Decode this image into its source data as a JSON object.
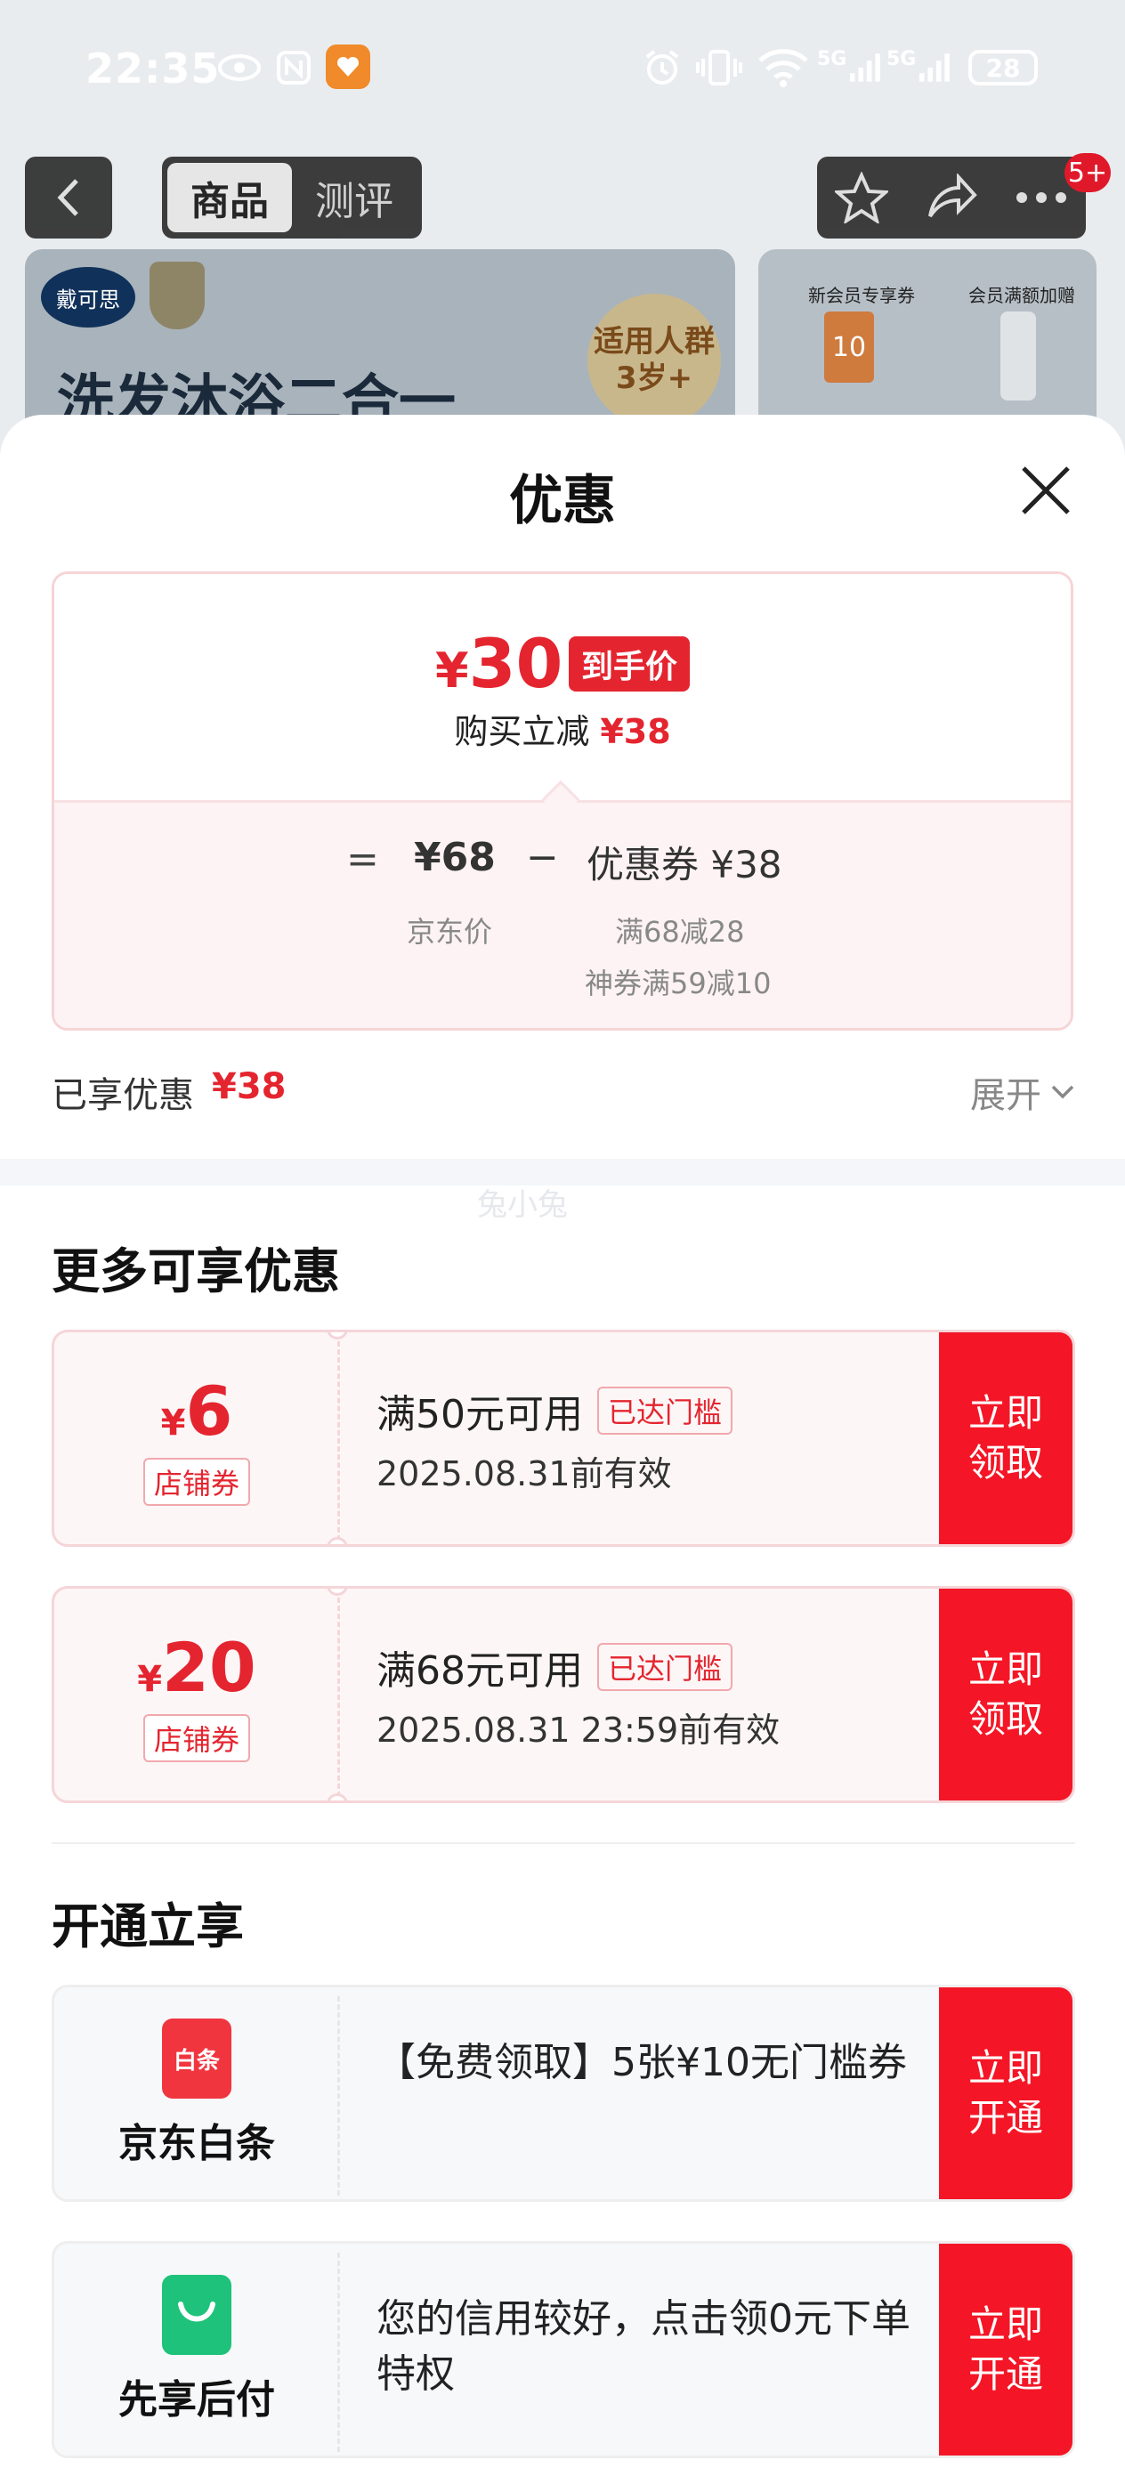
{
  "status_bar": {
    "time": "22:35",
    "signal1_label": "5G",
    "signal2_label": "5G",
    "battery": "28"
  },
  "nav": {
    "tabs": [
      "商品",
      "测评"
    ],
    "badge": "5+"
  },
  "banner": {
    "brand": "戴可思",
    "headline": "洗发沐浴二合一",
    "age_badge_line1": "适用人群",
    "age_badge_line2": "3岁+",
    "right_label1": "新会员专享券",
    "right_label2": "会员满额加赠",
    "right_coupon": "10"
  },
  "sheet": {
    "title": "优惠",
    "price": {
      "yen": "¥",
      "value": "30",
      "tag": "到手价",
      "instant_label": "购买立减",
      "instant_value": "¥38"
    },
    "calc": {
      "eq": "=",
      "jd_price": "¥68",
      "minus": "−",
      "coupon_total": "优惠券 ¥38",
      "jd_price_label": "京东价",
      "detail1": "满68减28",
      "detail2": "神券满59减10"
    },
    "enjoyed": {
      "label": "已享优惠",
      "value": "¥38",
      "expand": "展开"
    },
    "watermark": "兔小兔",
    "more_title": "更多可享优惠",
    "coupons": [
      {
        "yen": "¥",
        "amount": "6",
        "type": "店铺券",
        "condition": "满50元可用",
        "status": "已达门槛",
        "validity": "2025.08.31前有效",
        "button": "立即\n领取"
      },
      {
        "yen": "¥",
        "amount": "20",
        "type": "店铺券",
        "condition": "满68元可用",
        "status": "已达门槛",
        "validity": "2025.08.31 23:59前有效",
        "button": "立即\n领取"
      }
    ],
    "open_title": "开通立享",
    "services": [
      {
        "icon_text": "白条",
        "name": "京东白条",
        "text": "【免费领取】5张¥10无门槛券",
        "button": "立即\n开通",
        "icon_color": "#f0353f"
      },
      {
        "icon_text": "",
        "name": "先享后付",
        "text": "您的信用较好，点击领0元下单特权",
        "button": "立即\n开通",
        "icon_color": "#1ec27a"
      }
    ]
  }
}
